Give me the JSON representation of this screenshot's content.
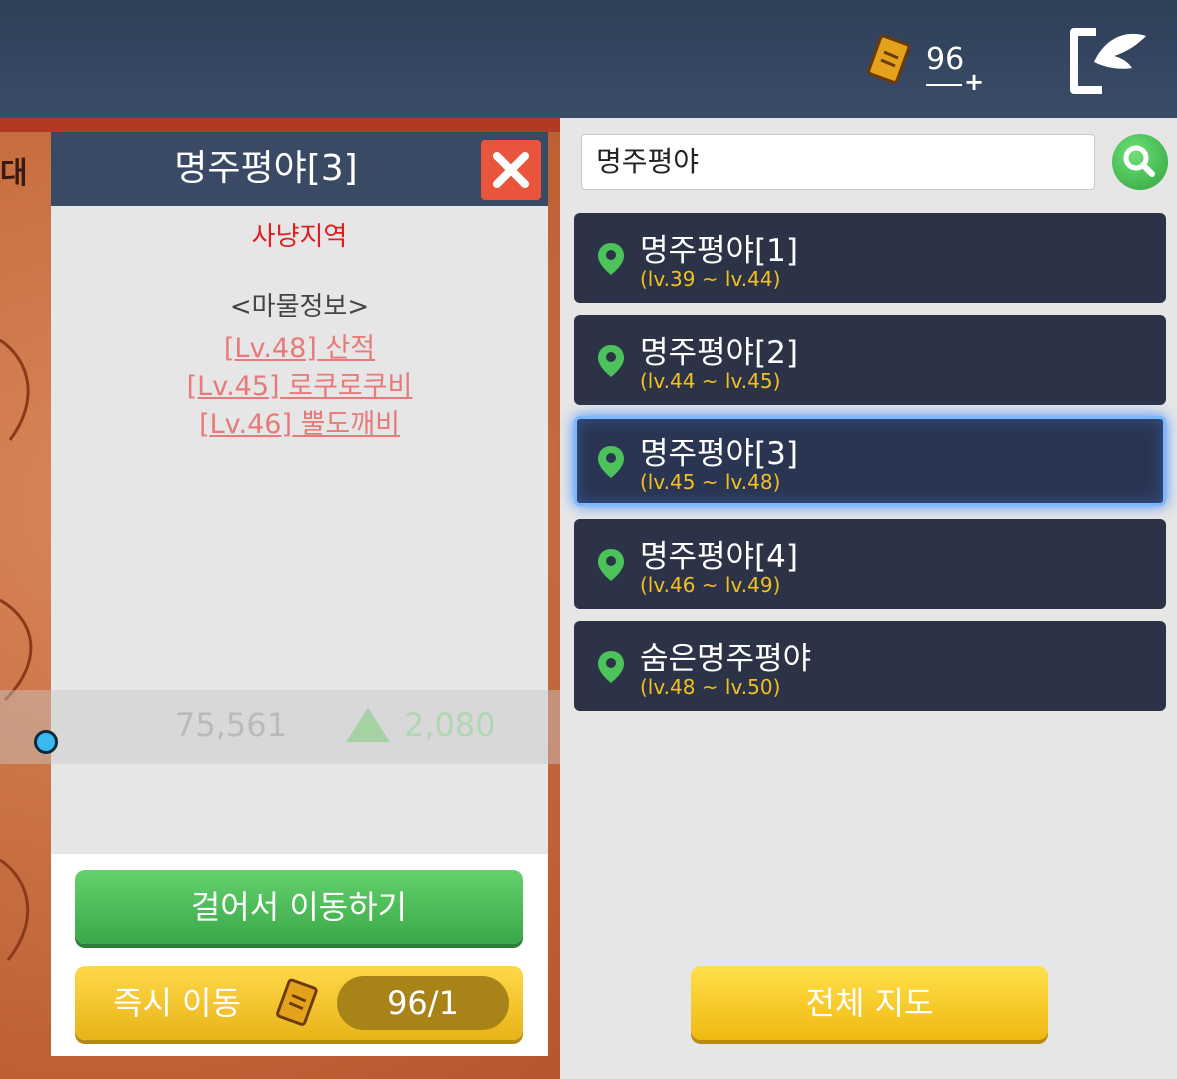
{
  "header": {
    "currency_value": "96",
    "currency_plus": "+"
  },
  "map": {
    "fragment_label": "대",
    "overlay_value": "75,561",
    "overlay_change": "2,080"
  },
  "info_panel": {
    "title": "명주평야[3]",
    "zone_type": "사냥지역",
    "monster_header": "<마물정보>",
    "monsters": [
      "[Lv.48] 산적",
      "[Lv.45] 로쿠로쿠비",
      "[Lv.46] 뿔도깨비"
    ],
    "walk_button": "걸어서 이동하기",
    "teleport_button": "즉시 이동",
    "teleport_cost": "96/1"
  },
  "search": {
    "value": "명주평야"
  },
  "zones": [
    {
      "name": "명주평야[1]",
      "level": "(lv.39 ~ lv.44)",
      "selected": false
    },
    {
      "name": "명주평야[2]",
      "level": "(lv.44 ~ lv.45)",
      "selected": false
    },
    {
      "name": "명주평야[3]",
      "level": "(lv.45 ~ lv.48)",
      "selected": true
    },
    {
      "name": "명주평야[4]",
      "level": "(lv.46 ~ lv.49)",
      "selected": false
    },
    {
      "name": "숨은명주평야",
      "level": "(lv.48 ~ lv.50)",
      "selected": false
    }
  ],
  "full_map_button": "전체 지도",
  "colors": {
    "header_bg": "#3b4c68",
    "walk_green": "#3aa84a",
    "gold": "#f0b810",
    "zone_level": "#f2c020",
    "zone_type_red": "#e02020"
  }
}
